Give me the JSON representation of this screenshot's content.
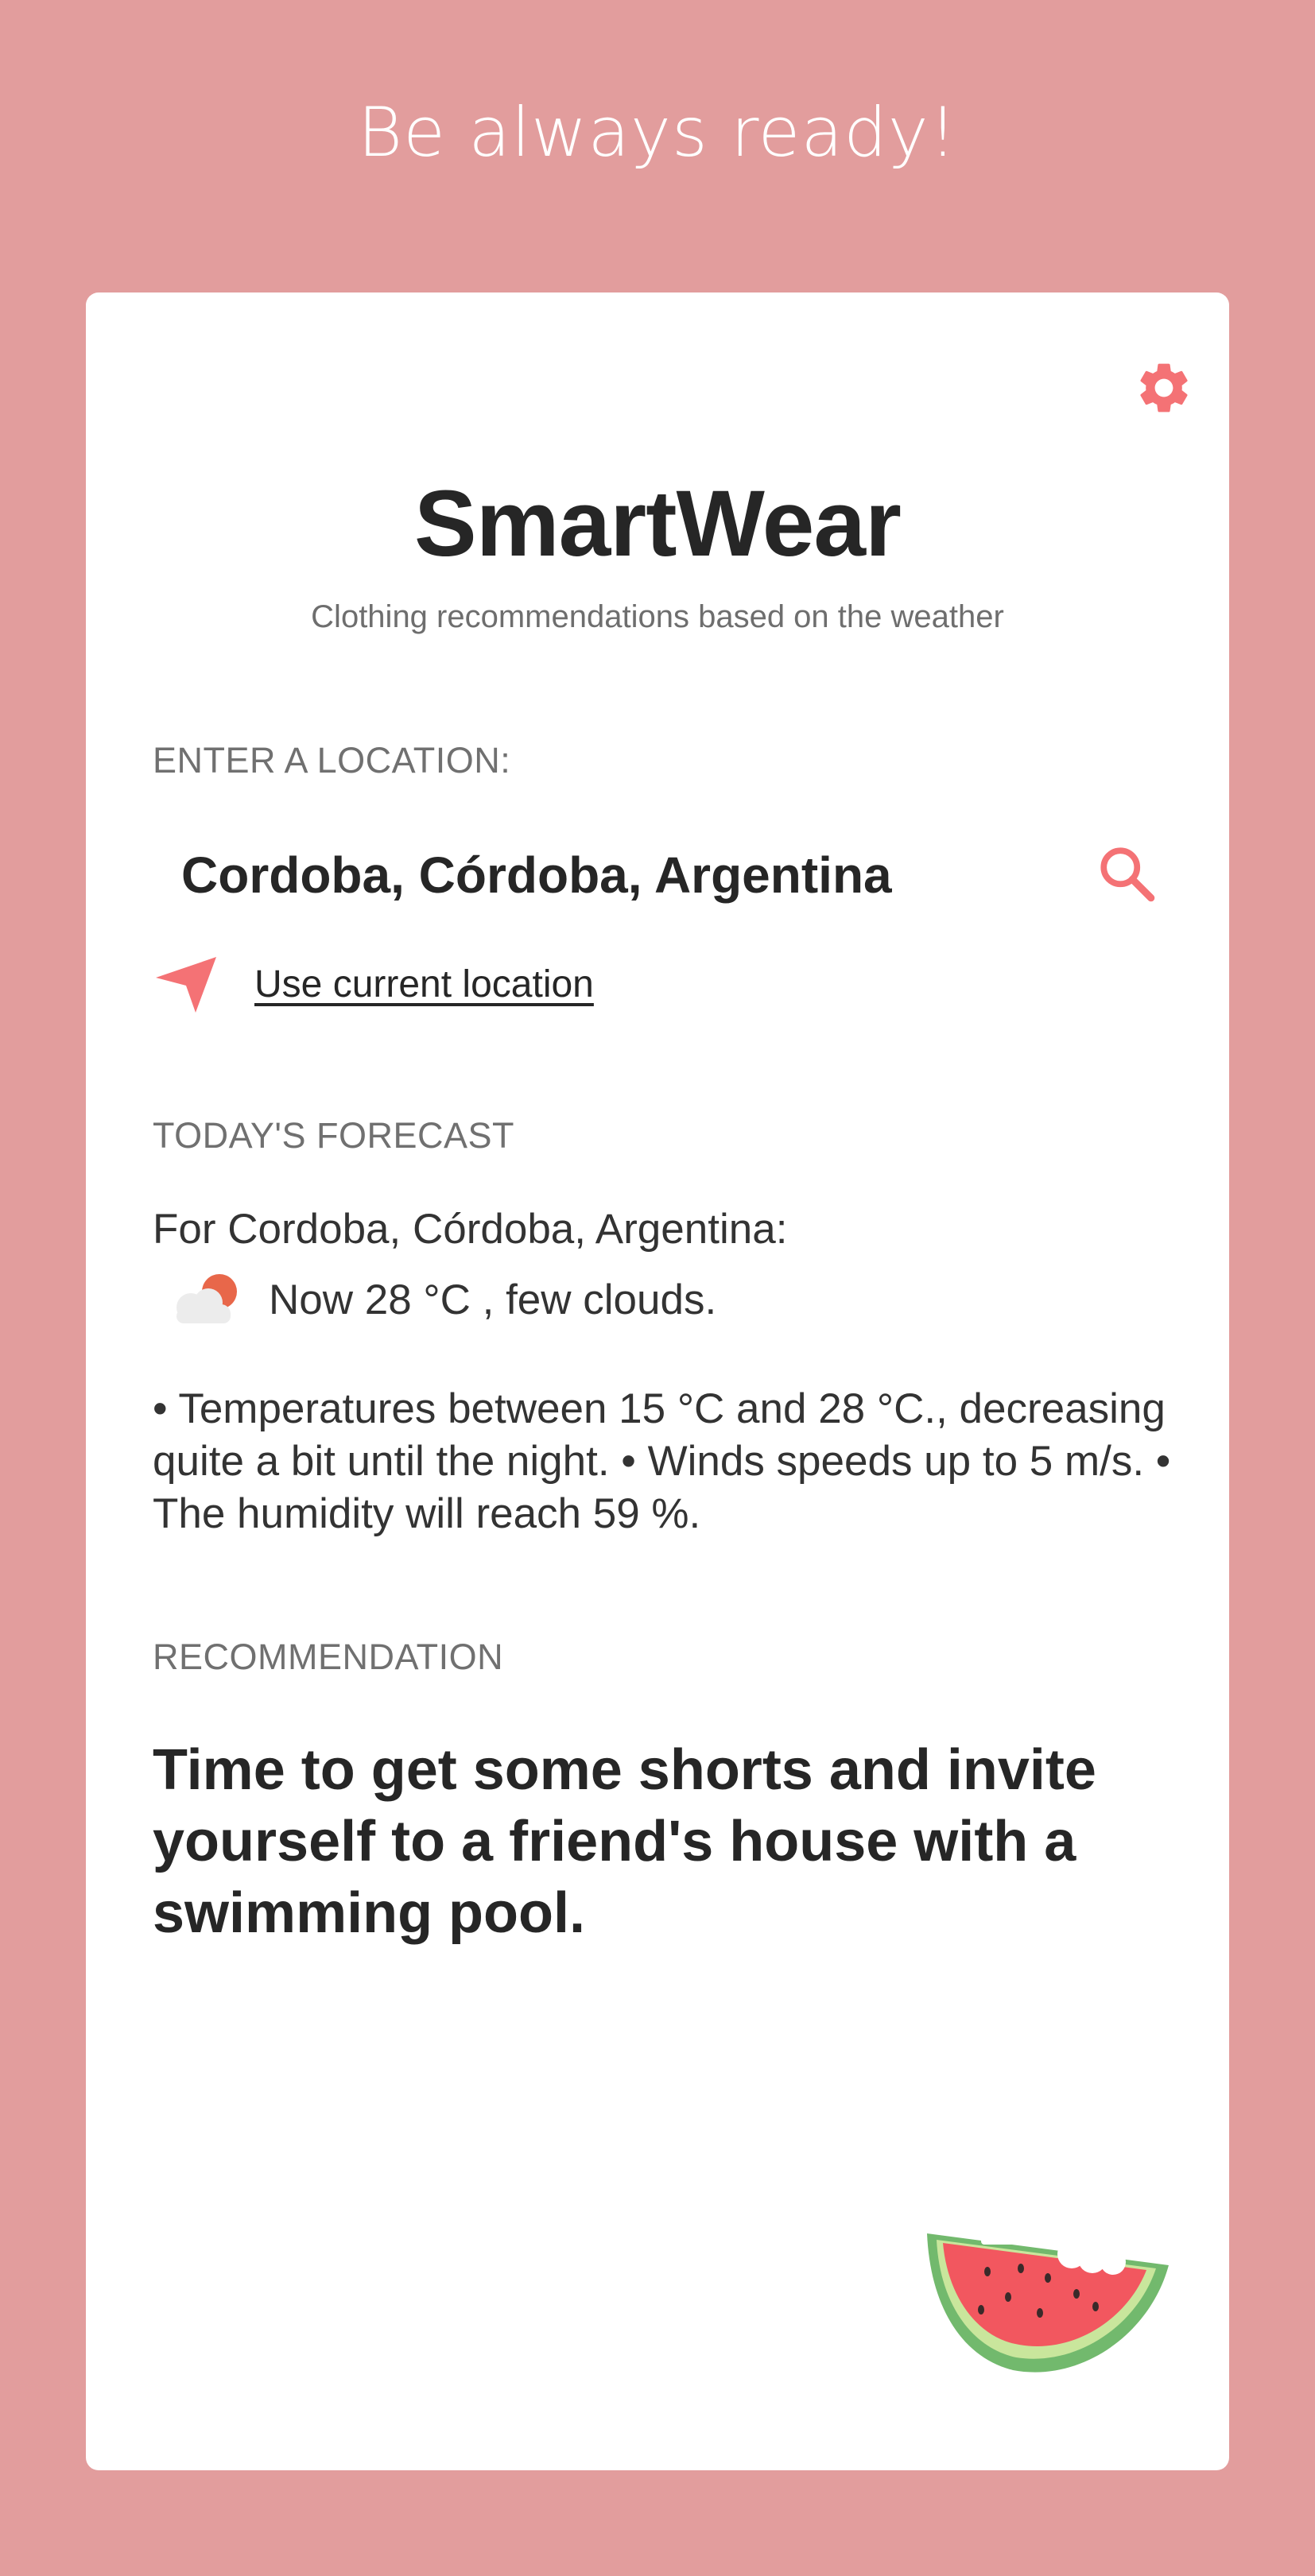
{
  "header": {
    "tagline": "Be always ready!"
  },
  "app": {
    "title": "SmartWear",
    "subtitle": "Clothing recommendations based on the weather"
  },
  "location": {
    "label": "ENTER A LOCATION:",
    "value": "Cordoba, Córdoba, Argentina",
    "use_current_label": "Use current location"
  },
  "forecast": {
    "label": "TODAY'S FORECAST",
    "for_line": "For Cordoba, Córdoba, Argentina:",
    "now_line": "Now 28 °C , few clouds.",
    "details": "• Temperatures between 15 °C and 28 °C., decreasing quite a bit until the night. • Winds speeds up to 5 m/s. • The humidity will reach 59 %."
  },
  "recommendation": {
    "label": "RECOMMENDATION",
    "text": "Time to get some shorts and invite yourself to a friend's house with a swimming pool."
  },
  "icons": {
    "settings": "gear-icon",
    "search": "search-icon",
    "location": "navigation-arrow-icon",
    "weather": "few-clouds-icon",
    "illustration": "watermelon-icon"
  },
  "colors": {
    "background": "#e29d9d",
    "card": "#ffffff",
    "accent": "#f47275",
    "text_dark": "#262626",
    "text_muted": "#707070"
  }
}
